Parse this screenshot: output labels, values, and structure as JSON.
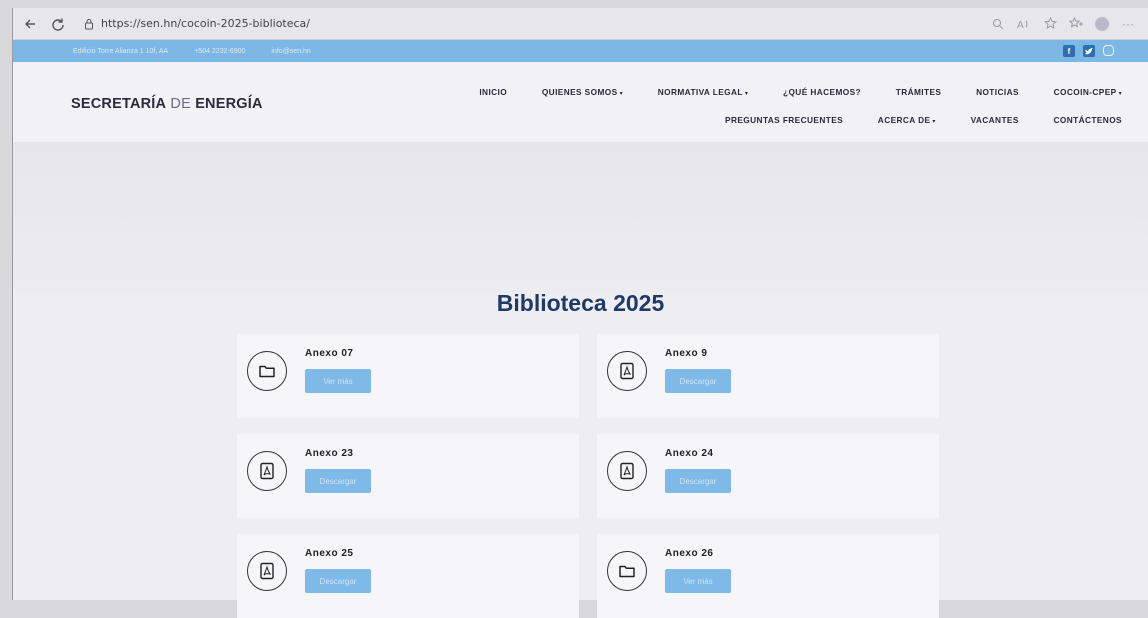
{
  "browser": {
    "url": "https://sen.hn/cocoin-2025-biblioteca/",
    "icons": [
      "back-icon",
      "refresh-icon",
      "lock-icon",
      "zoom-icon",
      "read-aloud-icon",
      "favorite-icon",
      "collections-icon",
      "profile-icon",
      "more-icon"
    ],
    "more_label": "···"
  },
  "topstrip": {
    "address": "Edificio Torre Alianza 1 10f, AA",
    "phone": "+504 2232-6900",
    "email": "info@sen.hn",
    "social": [
      "facebook-icon",
      "twitter-icon",
      "instagram-icon"
    ]
  },
  "header": {
    "logo_bold1": "SECRETARÍA",
    "logo_thin": " DE ",
    "logo_bold2": "ENERGÍA"
  },
  "menu": {
    "items": [
      {
        "label": "INICIO",
        "caret": ""
      },
      {
        "label": "QUIENES SOMOS",
        "caret": "▾"
      },
      {
        "label": "NORMATIVA LEGAL",
        "caret": "▾"
      },
      {
        "label": "¿QUÉ HACEMOS?",
        "caret": ""
      },
      {
        "label": "TRÁMITES",
        "caret": ""
      },
      {
        "label": "NOTICIAS",
        "caret": ""
      },
      {
        "label": "COCOIN-CPEP",
        "caret": "▾"
      },
      {
        "label": "PREGUNTAS FRECUENTES",
        "caret": ""
      },
      {
        "label": "ACERCA DE",
        "caret": "▾"
      },
      {
        "label": "VACANTES",
        "caret": ""
      },
      {
        "label": "CONTÁCTENOS",
        "caret": ""
      }
    ]
  },
  "main": {
    "title": "Biblioteca 2025",
    "cards": [
      {
        "title": "Anexo 07",
        "icon": "folder-icon",
        "button": "Ver más"
      },
      {
        "title": "Anexo 9",
        "icon": "pdf-icon",
        "button": "Descargar"
      },
      {
        "title": "Anexo 23",
        "icon": "pdf-icon",
        "button": "Descargar"
      },
      {
        "title": "Anexo 24",
        "icon": "pdf-icon",
        "button": "Descargar"
      },
      {
        "title": "Anexo 25",
        "icon": "pdf-icon",
        "button": "Descargar"
      },
      {
        "title": "Anexo 26",
        "icon": "folder-icon",
        "button": "Ver más"
      }
    ]
  },
  "colors": {
    "topstrip": "#7cb7e6",
    "button": "#7fb9e8",
    "title": "#1f3a66"
  }
}
